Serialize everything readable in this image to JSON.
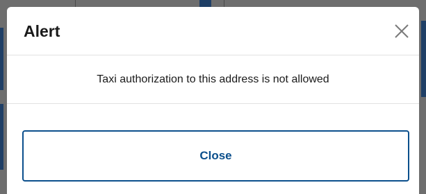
{
  "dialog": {
    "title": "Alert",
    "message": "Taxi authorization to this address is not allowed",
    "close_button_label": "Close",
    "dismiss_icon": "close-icon",
    "accent_color": "#0b4f8c"
  }
}
